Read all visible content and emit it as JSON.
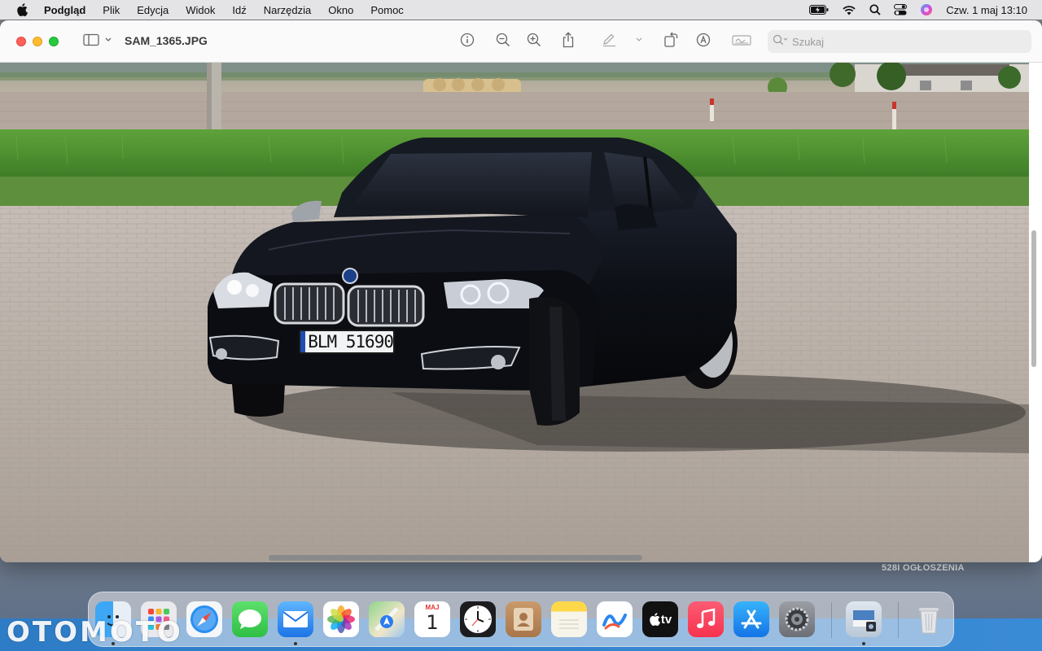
{
  "menubar": {
    "app_name": "Podgląd",
    "items": [
      "Plik",
      "Edycja",
      "Widok",
      "Idź",
      "Narzędzia",
      "Okno",
      "Pomoc"
    ],
    "clock": "Czw. 1 maj  13:10",
    "status_icons": [
      "battery-icon",
      "wifi-icon",
      "spotlight-search-icon",
      "control-center-icon",
      "siri-icon"
    ]
  },
  "window": {
    "title": "SAM_1365.JPG",
    "toolbar_icons": [
      "sidebar-toggle-icon",
      "info-icon",
      "zoom-out-icon",
      "zoom-in-icon",
      "share-icon",
      "markup-pen-icon",
      "rotate-icon",
      "annotate-icon",
      "signature-icon"
    ],
    "search": {
      "placeholder": "Szukaj",
      "value": ""
    }
  },
  "photo": {
    "license_plate": "BLM 51690",
    "subject": "black BMW sedan"
  },
  "desktop": {
    "label": "528I OGŁOSZENIA",
    "watermark": "OTOMOTO"
  },
  "dock": {
    "apps": [
      "Finder",
      "Launchpad",
      "Safari",
      "Wiadomości",
      "Mail",
      "Zdjęcia",
      "Mapy",
      "Kalendarz",
      "Zegar",
      "Kontakty",
      "Notatki",
      "Freeform",
      "TV",
      "Muzyka",
      "App Store",
      "Ustawienia systemowe",
      "Podgląd",
      "Kosz"
    ],
    "calendar_month": "MAJ",
    "calendar_day": "1",
    "tv_label": "tv"
  },
  "colors": {
    "car": "#12151b",
    "pavement": "#b3aba3",
    "grass": "#4a8f2f",
    "sky_field": "#c9c3bb"
  }
}
